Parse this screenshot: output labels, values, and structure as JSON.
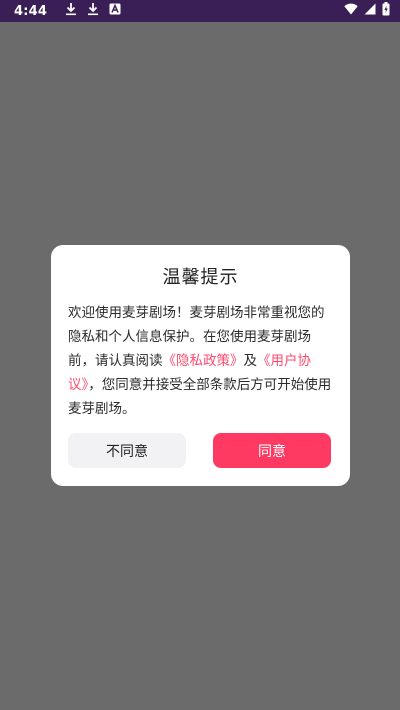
{
  "status_bar": {
    "time": "4:44",
    "left_icons": [
      "download-icon",
      "download-icon",
      "accessibility-icon"
    ],
    "right_icons": [
      "wifi-icon",
      "signal-icon",
      "battery-icon"
    ]
  },
  "dialog": {
    "title": "温馨提示",
    "body_part1": "欢迎使用麦芽剧场！麦芽剧场非常重视您的隐私和个人信息保护。在您使用麦芽剧场前，请认真阅读",
    "privacy_link": "《隐私政策》",
    "body_and": "及",
    "user_link": "《用户协议》",
    "body_part2": "，您同意并接受全部条款后方可开始使用麦芽剧场。",
    "disagree_label": "不同意",
    "agree_label": "同意"
  },
  "colors": {
    "status_bar_bg": "#3a1f57",
    "overlay": "#6b6b6b",
    "link": "#ff4a6e",
    "primary_button": "#ff3a62",
    "secondary_button": "#f2f2f4"
  }
}
